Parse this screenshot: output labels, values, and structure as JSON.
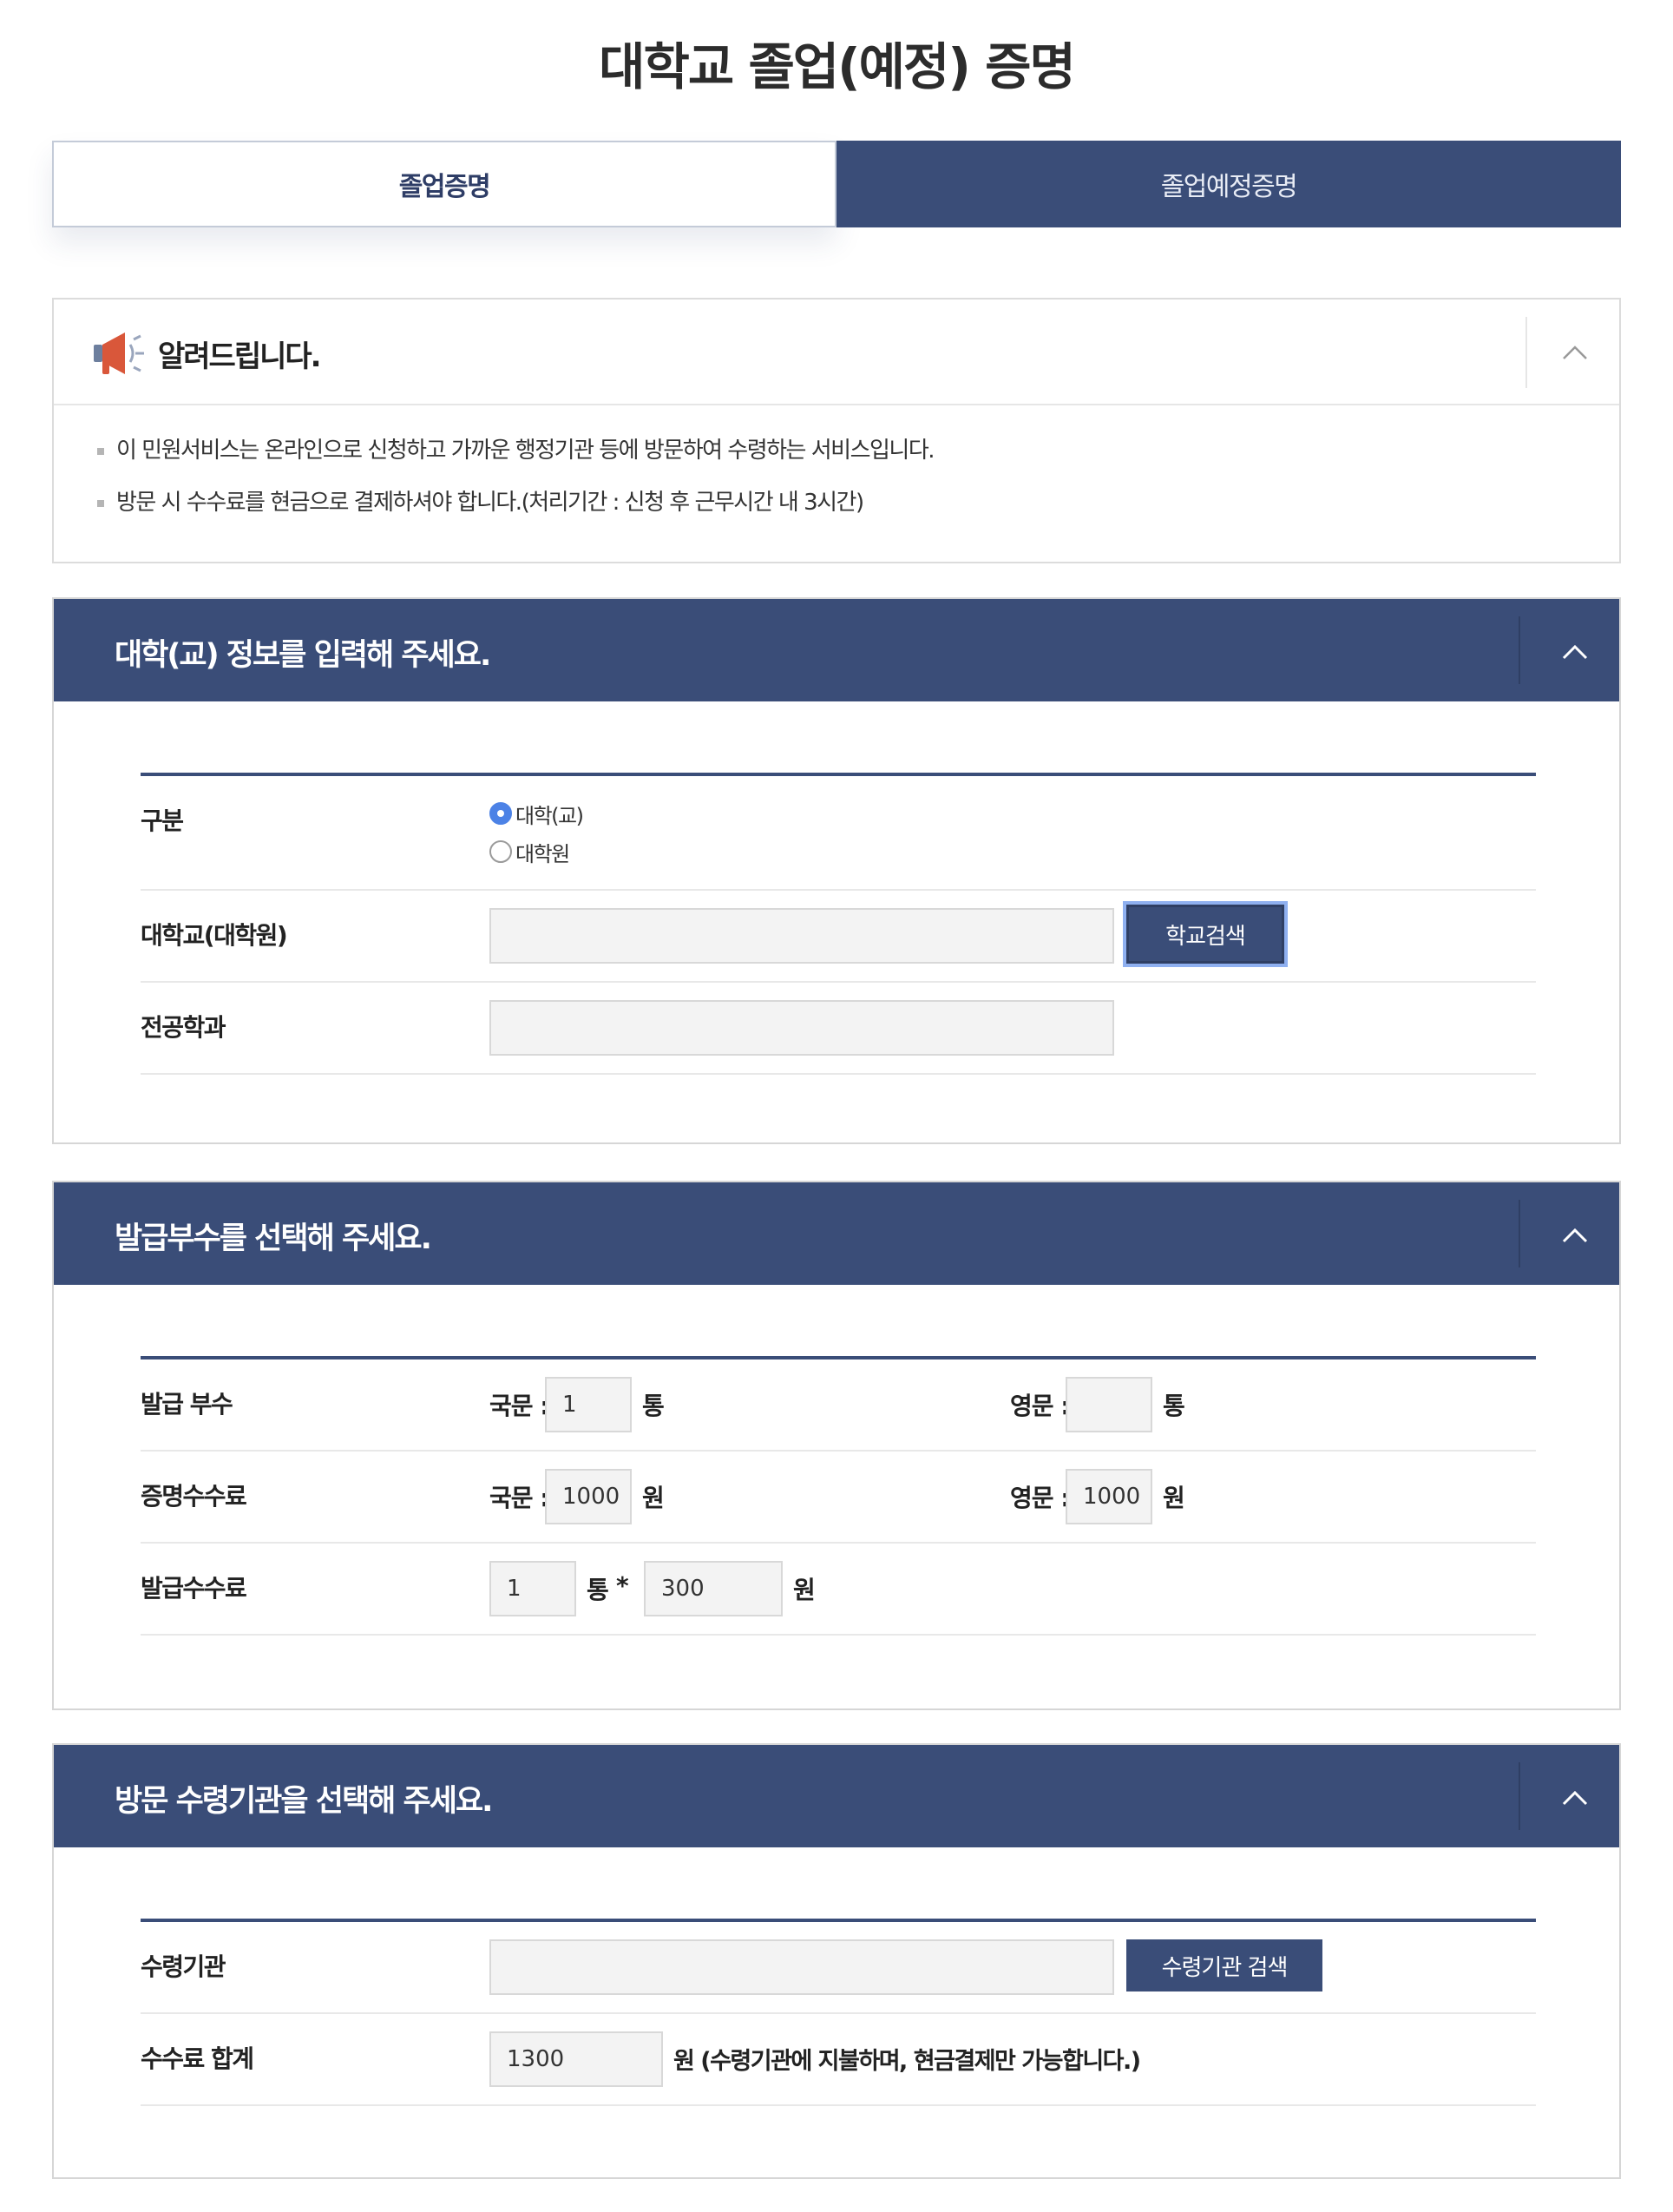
{
  "page_title": "대학교 졸업(예정) 증명",
  "tabs": [
    {
      "label": "졸업증명",
      "active": true
    },
    {
      "label": "졸업예정증명",
      "active": false
    }
  ],
  "notice": {
    "title": "알려드립니다.",
    "lines": [
      "이 민원서비스는 온라인으로 신청하고 가까운 행정기관 등에 방문하여 수령하는 서비스입니다.",
      "방문 시 수수료를 현금으로 결제하셔야 합니다.(처리기간 : 신청 후 근무시간 내 3시간)"
    ],
    "toggle_icon": "chevron-up-icon"
  },
  "school_section": {
    "title": "대학(교) 정보를 입력해 주세요.",
    "category": {
      "label": "구분",
      "options": [
        {
          "label": "대학(교)",
          "checked": true
        },
        {
          "label": "대학원",
          "checked": false
        }
      ]
    },
    "university": {
      "label": "대학교(대학원)",
      "value": "",
      "button": "학교검색"
    },
    "major": {
      "label": "전공학과",
      "value": ""
    }
  },
  "copies_section": {
    "title": "발급부수를 선택해 주세요.",
    "copies": {
      "label": "발급 부수",
      "kor_label": "국문 :",
      "kor_value": "1",
      "kor_unit": "통",
      "eng_label": "영문 :",
      "eng_value": "",
      "eng_unit": "통"
    },
    "cert_fee": {
      "label": "증명수수료",
      "kor_label": "국문 :",
      "kor_value": "1000",
      "kor_unit": "원",
      "eng_label": "영문 :",
      "eng_value": "1000",
      "eng_unit": "원"
    },
    "issue_fee": {
      "label": "발급수수료",
      "count_value": "1",
      "count_unit": "통",
      "multiply": "*",
      "price_value": "300",
      "price_unit": "원"
    }
  },
  "pickup_section": {
    "title": "방문 수령기관을 선택해 주세요.",
    "agency": {
      "label": "수령기관",
      "value": "",
      "button": "수령기관 검색"
    },
    "total": {
      "label": "수수료 합계",
      "value": "1300",
      "note": "원 (수령기관에 지불하며, 현금결제만 가능합니다.)"
    }
  }
}
